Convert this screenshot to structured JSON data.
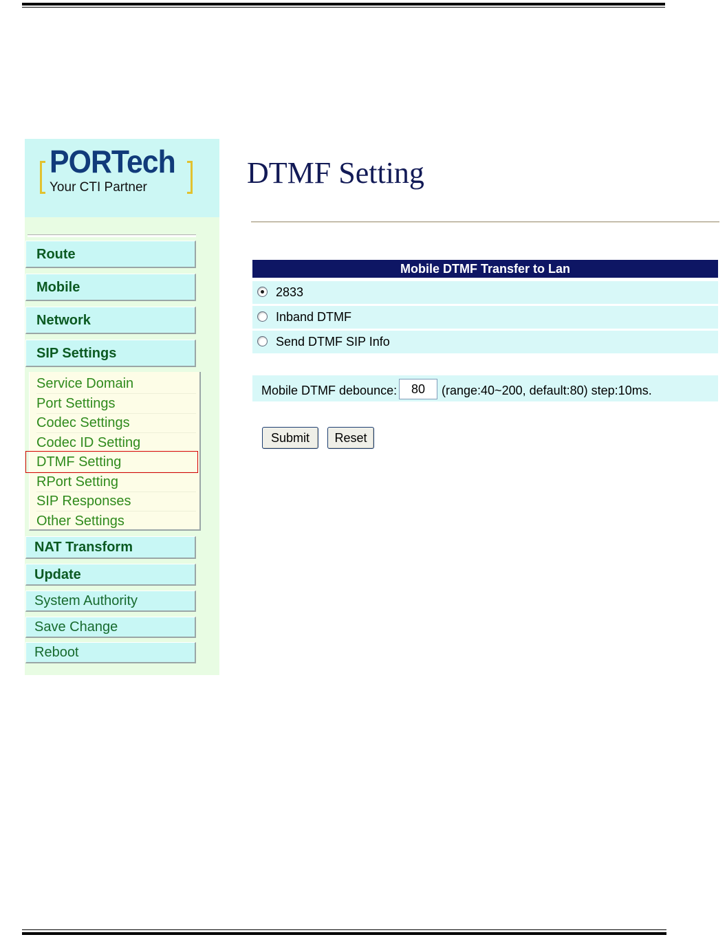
{
  "logo": {
    "brand": "PORTech",
    "tagline": "Your CTI Partner"
  },
  "sidebar": {
    "main_items": [
      {
        "label": "Route"
      },
      {
        "label": "Mobile"
      },
      {
        "label": "Network"
      },
      {
        "label": "SIP Settings"
      }
    ],
    "sip_submenu": [
      {
        "label": "Service Domain"
      },
      {
        "label": "Port Settings"
      },
      {
        "label": "Codec Settings"
      },
      {
        "label": "Codec ID Setting"
      },
      {
        "label": "DTMF Setting",
        "active": true
      },
      {
        "label": "RPort Setting"
      },
      {
        "label": "SIP Responses"
      },
      {
        "label": "Other Settings"
      }
    ],
    "lower_items": [
      {
        "label": "NAT Transform"
      },
      {
        "label": "Update"
      },
      {
        "label": "System Authority"
      },
      {
        "label": "Save Change"
      },
      {
        "label": "Reboot"
      }
    ]
  },
  "page": {
    "title": "DTMF Setting"
  },
  "dtmf_panel": {
    "header": "Mobile DTMF Transfer to Lan",
    "options": [
      {
        "label": "2833",
        "selected": true
      },
      {
        "label": "Inband DTMF",
        "selected": false
      },
      {
        "label": "Send DTMF SIP Info",
        "selected": false
      }
    ]
  },
  "debounce": {
    "label": "Mobile DTMF debounce:",
    "value": "80",
    "hint": "(range:40~200, default:80) step:10ms."
  },
  "buttons": {
    "submit": "Submit",
    "reset": "Reset"
  },
  "colors": {
    "header_bg": "#0e1664",
    "sidebar_bg": "#e8fce3",
    "nav_button_bg": "#c8f7f5",
    "active_outline": "#d40000"
  }
}
